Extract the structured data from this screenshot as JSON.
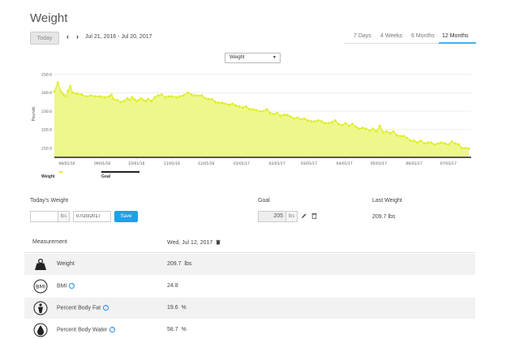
{
  "page": {
    "title": "Weight"
  },
  "toolbar": {
    "today_label": "Today",
    "prev_arrow": "‹",
    "next_arrow": "›",
    "date_range": "Jul 21, 2016 - Jul 20, 2017",
    "range_tabs": [
      {
        "label": "7 Days",
        "active": false
      },
      {
        "label": "4 Weeks",
        "active": false
      },
      {
        "label": "6 Months",
        "active": false
      },
      {
        "label": "12 Months",
        "active": true
      }
    ]
  },
  "metric_select": {
    "selected": "Weight"
  },
  "chart_data": {
    "type": "area",
    "ylabel": "Pounds",
    "xlabel": "",
    "ylim": [
      205,
      252
    ],
    "y_ticks": [
      210,
      220,
      230,
      240,
      250
    ],
    "y_tick_labels": [
      "210.0",
      "220.0",
      "230.0",
      "240.0",
      "250.0"
    ],
    "x_range": [
      0,
      365
    ],
    "x_ticks": [
      {
        "label": "08/01/16",
        "x": 11
      },
      {
        "label": "09/01/16",
        "x": 42
      },
      {
        "label": "10/01/16",
        "x": 72
      },
      {
        "label": "11/01/16",
        "x": 103
      },
      {
        "label": "12/01/16",
        "x": 133
      },
      {
        "label": "01/01/17",
        "x": 164
      },
      {
        "label": "02/01/17",
        "x": 195
      },
      {
        "label": "03/01/17",
        "x": 223
      },
      {
        "label": "04/01/17",
        "x": 254
      },
      {
        "label": "05/01/17",
        "x": 284
      },
      {
        "label": "06/01/17",
        "x": 315
      },
      {
        "label": "07/01/17",
        "x": 345
      }
    ],
    "series": [
      {
        "name": "Weight",
        "color": "#dfee2a",
        "points": [
          [
            0,
            240.5
          ],
          [
            3,
            245.5
          ],
          [
            6,
            240.5
          ],
          [
            8,
            239
          ],
          [
            10,
            238
          ],
          [
            12,
            241
          ],
          [
            14,
            243.5
          ],
          [
            16,
            240
          ],
          [
            20,
            239.5
          ],
          [
            24,
            239
          ],
          [
            28,
            238
          ],
          [
            32,
            238.5
          ],
          [
            36,
            238
          ],
          [
            40,
            238
          ],
          [
            44,
            237.5
          ],
          [
            48,
            238
          ],
          [
            50,
            239
          ],
          [
            52,
            236.5
          ],
          [
            55,
            236
          ],
          [
            58,
            235
          ],
          [
            61,
            235.5
          ],
          [
            64,
            237
          ],
          [
            66,
            236
          ],
          [
            68,
            237.5
          ],
          [
            70,
            236.5
          ],
          [
            72,
            235.5
          ],
          [
            74,
            236
          ],
          [
            76,
            237
          ],
          [
            78,
            236
          ],
          [
            80,
            235.5
          ],
          [
            82,
            236.5
          ],
          [
            85,
            235.5
          ],
          [
            88,
            237.5
          ],
          [
            91,
            238.5
          ],
          [
            94,
            239
          ],
          [
            97,
            237.5
          ],
          [
            100,
            238
          ],
          [
            103,
            238
          ],
          [
            107,
            237.5
          ],
          [
            110,
            238
          ],
          [
            113,
            238.5
          ],
          [
            117,
            240
          ],
          [
            120,
            239
          ],
          [
            123,
            238.5
          ],
          [
            126,
            238.5
          ],
          [
            129,
            238.5
          ],
          [
            132,
            237
          ],
          [
            135,
            236.5
          ],
          [
            138,
            236.5
          ],
          [
            141,
            235
          ],
          [
            144,
            234.5
          ],
          [
            147,
            234.5
          ],
          [
            150,
            234
          ],
          [
            153,
            233.5
          ],
          [
            156,
            234
          ],
          [
            159,
            233
          ],
          [
            162,
            232.5
          ],
          [
            165,
            232
          ],
          [
            168,
            232.5
          ],
          [
            171,
            231
          ],
          [
            174,
            231
          ],
          [
            177,
            230.5
          ],
          [
            180,
            230
          ],
          [
            183,
            230
          ],
          [
            186,
            231
          ],
          [
            189,
            229
          ],
          [
            192,
            228.5
          ],
          [
            195,
            229
          ],
          [
            198,
            227.5
          ],
          [
            201,
            228
          ],
          [
            204,
            228
          ],
          [
            207,
            227
          ],
          [
            210,
            226
          ],
          [
            213,
            226.5
          ],
          [
            216,
            225.5
          ],
          [
            219,
            226
          ],
          [
            222,
            225
          ],
          [
            225,
            224.5
          ],
          [
            228,
            224.5
          ],
          [
            231,
            225
          ],
          [
            234,
            224.5
          ],
          [
            237,
            223.5
          ],
          [
            240,
            223.5
          ],
          [
            243,
            224
          ],
          [
            246,
            225
          ],
          [
            249,
            223
          ],
          [
            252,
            222.5
          ],
          [
            255,
            223.5
          ],
          [
            258,
            222
          ],
          [
            261,
            223
          ],
          [
            264,
            221.5
          ],
          [
            267,
            220.5
          ],
          [
            270,
            221
          ],
          [
            273,
            220.5
          ],
          [
            276,
            219.5
          ],
          [
            279,
            220.5
          ],
          [
            282,
            219
          ],
          [
            285,
            222
          ],
          [
            288,
            218.5
          ],
          [
            291,
            219
          ],
          [
            294,
            218
          ],
          [
            297,
            219
          ],
          [
            300,
            217
          ],
          [
            303,
            216.5
          ],
          [
            306,
            216.5
          ],
          [
            309,
            215.5
          ],
          [
            312,
            214
          ],
          [
            315,
            214
          ],
          [
            318,
            213
          ],
          [
            321,
            214
          ],
          [
            324,
            212.5
          ],
          [
            327,
            213
          ],
          [
            330,
            213
          ],
          [
            333,
            212
          ],
          [
            336,
            212.5
          ],
          [
            339,
            213
          ],
          [
            342,
            212.5
          ],
          [
            345,
            212
          ],
          [
            348,
            213.5
          ],
          [
            351,
            212.5
          ],
          [
            354,
            212
          ],
          [
            357,
            210
          ],
          [
            360,
            210
          ],
          [
            363,
            209.7
          ]
        ]
      },
      {
        "name": "Goal",
        "color": "#000000",
        "points": [
          [
            0,
            205
          ],
          [
            365,
            205
          ]
        ]
      }
    ],
    "grid": true,
    "legend_position": "bottom-left"
  },
  "today_weight": {
    "label": "Today's Weight",
    "weight_value": "",
    "weight_unit": "lbs",
    "date_value": "07/20/2017",
    "save_label": "Save"
  },
  "goal": {
    "label": "Goal",
    "value": "205",
    "unit": "lbs"
  },
  "last_weight": {
    "label": "Last Weight",
    "value": "209.7 lbs"
  },
  "measurements": {
    "header_label": "Measurement",
    "header_date": "Wed, Jul 12, 2017",
    "rows": [
      {
        "name": "Weight",
        "value": "209.7",
        "unit": "lbs",
        "icon": "scale-icon",
        "help": false
      },
      {
        "name": "BMI",
        "value": "24.8",
        "unit": "",
        "icon": "bmi-icon",
        "help": true
      },
      {
        "name": "Percent Body Fat",
        "value": "19.6",
        "unit": "%",
        "icon": "body-fat-icon",
        "help": true
      },
      {
        "name": "Percent Body Water",
        "value": "58.7",
        "unit": "%",
        "icon": "body-water-icon",
        "help": true
      }
    ]
  },
  "colors": {
    "accent": "#1aa3e8",
    "tab_underline": "#4ab0e6",
    "area_fill": "#eef78c",
    "series_line": "#dfee2a"
  }
}
